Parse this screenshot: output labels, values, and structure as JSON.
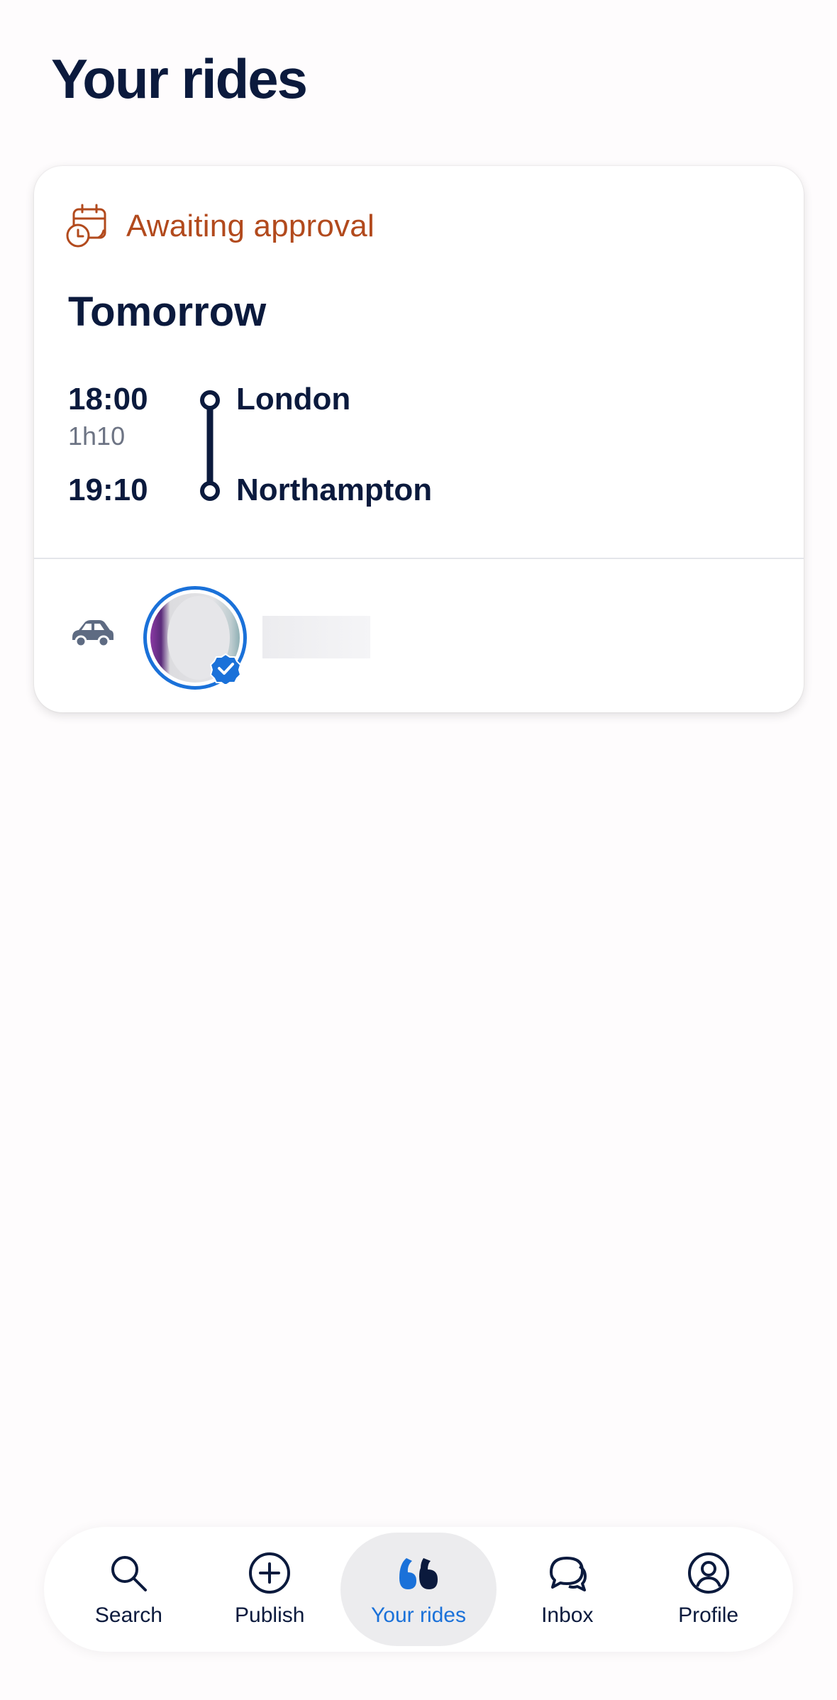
{
  "header": {
    "title": "Your rides"
  },
  "ride": {
    "status": "Awaiting approval",
    "status_icon": "calendar-clock-icon",
    "status_color": "#b24a1d",
    "date": "Tomorrow",
    "departure": {
      "time": "18:00",
      "city": "London"
    },
    "duration": "1h10",
    "arrival": {
      "time": "19:10",
      "city": "Northampton"
    },
    "driver": {
      "vehicle_icon": "car-icon",
      "verified": true
    }
  },
  "bottom_nav": {
    "active_color": "#1a71d9",
    "items": [
      {
        "label": "Search",
        "icon": "search-icon"
      },
      {
        "label": "Publish",
        "icon": "plus-circle-icon"
      },
      {
        "label": "Your rides",
        "icon": "your-rides-icon",
        "active": true
      },
      {
        "label": "Inbox",
        "icon": "chat-bubbles-icon"
      },
      {
        "label": "Profile",
        "icon": "user-circle-icon"
      }
    ]
  }
}
